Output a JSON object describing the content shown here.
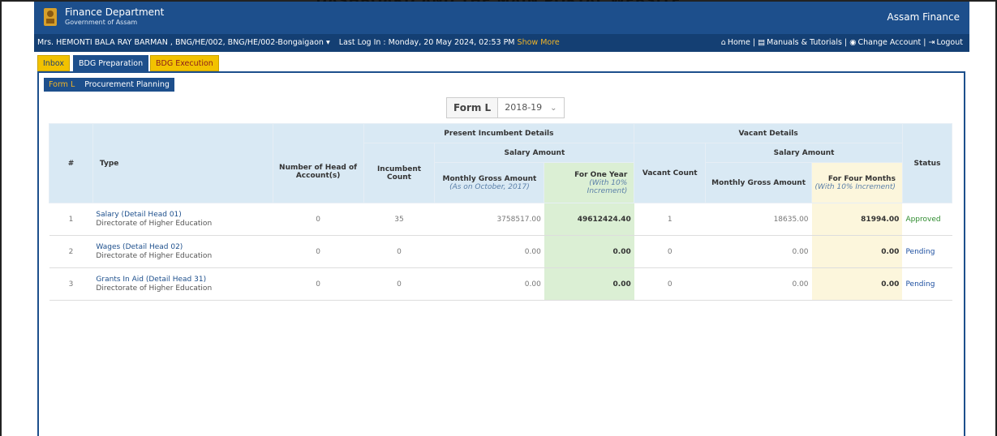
{
  "document": {
    "heading": "DASHBOARD AND THE MAIN PORTAL WEBSITE"
  },
  "header": {
    "brand_title": "Finance Department",
    "brand_subtitle": "Government of Assam",
    "brand_right": "Assam Finance"
  },
  "userbar": {
    "user": "Mrs. HEMONTI BALA RAY BARMAN , BNG/HE/002, BNG/HE/002-Bongaigaon",
    "dropdown_glyph": "▾",
    "last_log": "Last Log In : Monday, 20 May 2024, 02:53 PM",
    "show_more": "Show More",
    "links": {
      "home": "Home",
      "manuals": "Manuals & Tutorials",
      "change_account": "Change Account",
      "logout": "Logout",
      "separator": "|"
    },
    "icons": {
      "home": "home-icon",
      "manuals": "book-icon",
      "change_account": "user-circle-icon",
      "logout": "logout-icon"
    }
  },
  "tabs": {
    "inbox": "Inbox",
    "bdg_preparation": "BDG Preparation",
    "bdg_execution": "BDG Execution"
  },
  "subtabs": {
    "form_l": "Form L",
    "procurement_planning": "Procurement Planning"
  },
  "form_selector": {
    "label": "Form L",
    "selected_year": "2018-19"
  },
  "table": {
    "headers": {
      "index": "#",
      "type": "Type",
      "num_heads": "Number of Head of Account(s)",
      "present_group": "Present Incumbent Details",
      "vacant_group": "Vacant Details",
      "salary_amount": "Salary Amount",
      "incumbent_count": "Incumbent Count",
      "monthly_gross": "Monthly Gross Amount",
      "monthly_gross_note": "(As on October, 2017)",
      "for_one_year": "For One Year",
      "for_one_year_note": "(With 10% Increment)",
      "vacant_count": "Vacant Count",
      "vacant_monthly_gross": "Monthly Gross Amount",
      "for_four_months": "For Four Months",
      "for_four_months_note": "(With 10% Increment)",
      "status": "Status"
    },
    "rows": [
      {
        "index": "1",
        "type_name": "Salary (Detail Head 01)",
        "directorate": "Directorate of Higher Education",
        "num_heads": "0",
        "incumbent_count": "35",
        "monthly_gross": "3758517.00",
        "for_one_year": "49612424.40",
        "vacant_count": "1",
        "vacant_monthly_gross": "18635.00",
        "for_four_months": "81994.00",
        "status": "Approved"
      },
      {
        "index": "2",
        "type_name": "Wages (Detail Head 02)",
        "directorate": "Directorate of Higher Education",
        "num_heads": "0",
        "incumbent_count": "0",
        "monthly_gross": "0.00",
        "for_one_year": "0.00",
        "vacant_count": "0",
        "vacant_monthly_gross": "0.00",
        "for_four_months": "0.00",
        "status": "Pending"
      },
      {
        "index": "3",
        "type_name": "Grants In Aid (Detail Head 31)",
        "directorate": "Directorate of Higher Education",
        "num_heads": "0",
        "incumbent_count": "0",
        "monthly_gross": "0.00",
        "for_one_year": "0.00",
        "vacant_count": "0",
        "vacant_monthly_gross": "0.00",
        "for_four_months": "0.00",
        "status": "Pending"
      }
    ]
  },
  "colors": {
    "header_blue": "#1d4f8c",
    "user_bar_blue": "#143f73",
    "tab_yellow": "#f2c200",
    "highlight_green": "#dbefd4",
    "highlight_cream": "#fcf6dc",
    "status_approved": "#2e8b2e",
    "status_pending": "#1d4fa0"
  }
}
